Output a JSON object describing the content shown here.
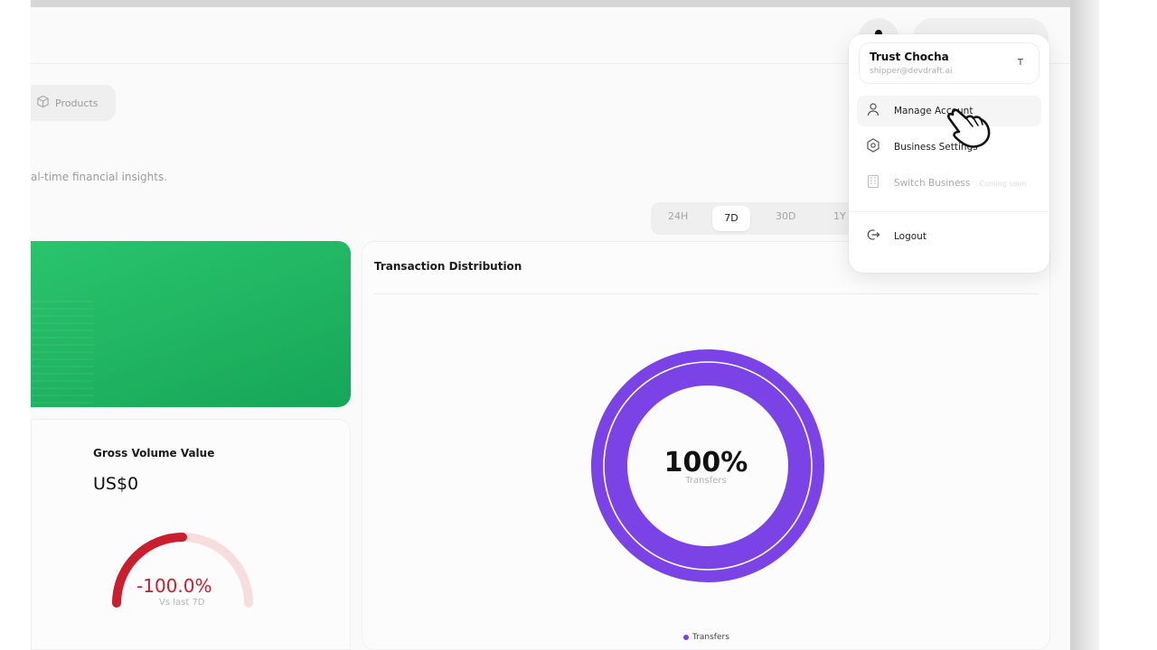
{
  "nav": {
    "products_label": "Products"
  },
  "page": {
    "subtitle": "al-time financial insights."
  },
  "range_tabs": [
    {
      "label": "24H",
      "active": false
    },
    {
      "label": "7D",
      "active": true
    },
    {
      "label": "30D",
      "active": false
    },
    {
      "label": "1Y",
      "active": false
    }
  ],
  "gross_volume": {
    "title": "Gross Volume Value",
    "value": "US$0",
    "change": "-100.0%",
    "change_sub": "Vs last 7D",
    "change_fraction": -1.0
  },
  "distribution": {
    "title": "Transaction Distribution",
    "center_value": "100%",
    "center_label": "Transfers",
    "legend": [
      {
        "label": "Transfers",
        "color": "#7b43e5"
      }
    ]
  },
  "user_menu": {
    "name": "Trust Chocha",
    "email": "shipper@devdraft.ai",
    "avatar_initial": "T",
    "items": [
      {
        "label": "Manage Account",
        "icon": "user-icon"
      },
      {
        "label": "Business Settings",
        "icon": "settings-hexagon-icon"
      },
      {
        "label": "Switch Business",
        "icon": "building-icon",
        "badge": "Coming soon",
        "disabled": true
      },
      {
        "label": "Logout",
        "icon": "logout-icon"
      }
    ]
  },
  "colors": {
    "accent_purple": "#7b43e5",
    "success_green": "#22c065",
    "danger_red": "#c81e2e"
  }
}
